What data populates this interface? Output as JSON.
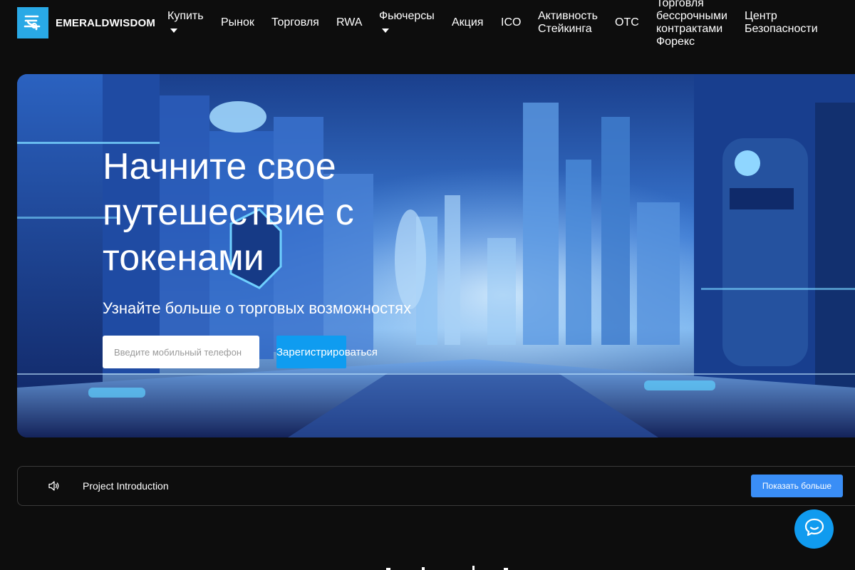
{
  "brand": {
    "name": "EMERALDWISDOM",
    "accent": "#29a9e6"
  },
  "nav": {
    "items": [
      {
        "label": "Купить",
        "has_dropdown": true
      },
      {
        "label": "Рынок"
      },
      {
        "label": "Торговля"
      },
      {
        "label": "RWA"
      },
      {
        "label": "Фьючерсы",
        "has_dropdown": true
      },
      {
        "label": "Акция"
      },
      {
        "label": "ICO"
      },
      {
        "label": "Активность\nСтейкинга"
      },
      {
        "label": "OTC"
      },
      {
        "label": "Торговля\nбессрочными\nконтрактами\nФорекс"
      },
      {
        "label": "Центр\nБезопасности"
      }
    ]
  },
  "hero": {
    "title": "Начните свое путешествие с токенами",
    "subtitle": "Узнайте больше о торговых возможностях",
    "phone_placeholder": "Введите мобильный телефон",
    "register_label": "Зарегистрироваться",
    "register_color": "#0f9cf0"
  },
  "notice": {
    "icon": "speaker-icon",
    "text": "Project Introduction",
    "more_label": "Показать больше",
    "more_color": "#3a8ef6"
  },
  "chat": {
    "icon": "chat-bubble-icon",
    "color": "#109bef"
  }
}
